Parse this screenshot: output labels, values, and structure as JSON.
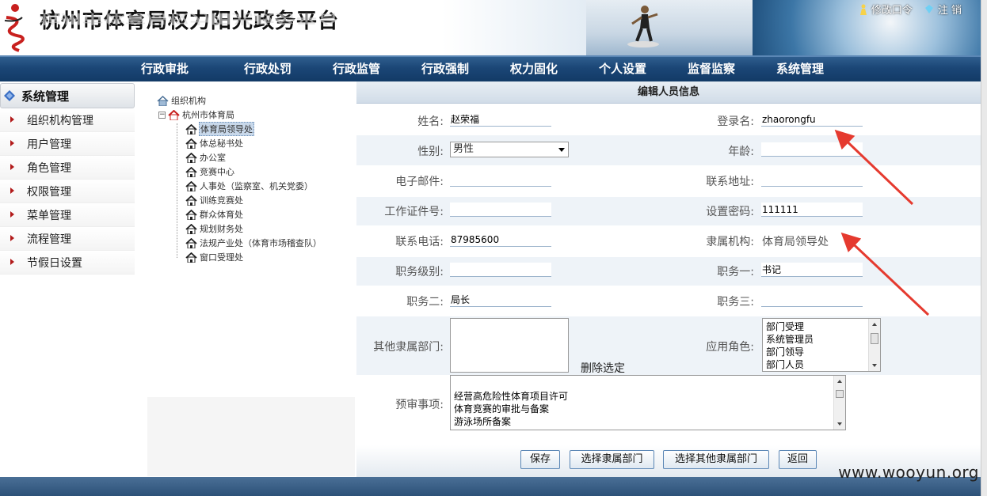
{
  "header": {
    "title": "杭州市体育局权力阳光政务平台",
    "change_password": "修改口令",
    "logout": "注 销"
  },
  "nav": [
    "行政审批",
    "行政处罚",
    "行政监管",
    "行政强制",
    "权力固化",
    "个人设置",
    "监督监察",
    "系统管理"
  ],
  "sidebar": {
    "title": "系统管理",
    "items": [
      "组织机构管理",
      "用户管理",
      "角色管理",
      "权限管理",
      "菜单管理",
      "流程管理",
      "节假日设置"
    ]
  },
  "tree": {
    "root": "组织机构",
    "org": "杭州市体育局",
    "children": [
      "体育局领导处",
      "体总秘书处",
      "办公室",
      "竞赛中心",
      "人事处（监察室、机关党委）",
      "训练竞赛处",
      "群众体育处",
      "规划财务处",
      "法规产业处（体育市场稽查队）",
      "窗口受理处"
    ],
    "selected_index": 0
  },
  "form": {
    "title": "编辑人员信息",
    "labels": {
      "name": "姓名:",
      "login": "登录名:",
      "gender": "性别:",
      "age": "年龄:",
      "email": "电子邮件:",
      "address": "联系地址:",
      "id_no": "工作证件号:",
      "password": "设置密码:",
      "phone": "联系电话:",
      "org": "隶属机构:",
      "rank": "职务级别:",
      "duty1": "职务一:",
      "duty2": "职务二:",
      "duty3": "职务三:",
      "other_dept": "其他隶属部门:",
      "roles": "应用角色:",
      "pre_review": "预审事项:"
    },
    "values": {
      "name": "赵荣福",
      "login": "zhaorongfu",
      "gender": "男性",
      "age": "",
      "email": "",
      "address": "",
      "id_no": "",
      "password": "111111",
      "phone": "87985600",
      "org": "体育局领导处",
      "rank": "",
      "duty1": "书记",
      "duty2": "局长",
      "duty3": ""
    },
    "delete_selected": "删除选定",
    "roles_options": [
      "部门受理",
      "系统管理员",
      "部门领导",
      "部门人员"
    ],
    "pre_review_items": [
      "经营高危险性体育项目许可",
      "体育竞赛的审批与备案",
      "游泳场所备案"
    ],
    "buttons": {
      "save": "保存",
      "select_dept": "选择隶属部门",
      "select_other_dept": "选择其他隶属部门",
      "back": "返回"
    }
  },
  "watermark": "www.wooyun.org",
  "colors": {
    "nav_bg": "#1b4676",
    "alt_row": "#eef3f8",
    "arrow": "#e53a2f"
  }
}
